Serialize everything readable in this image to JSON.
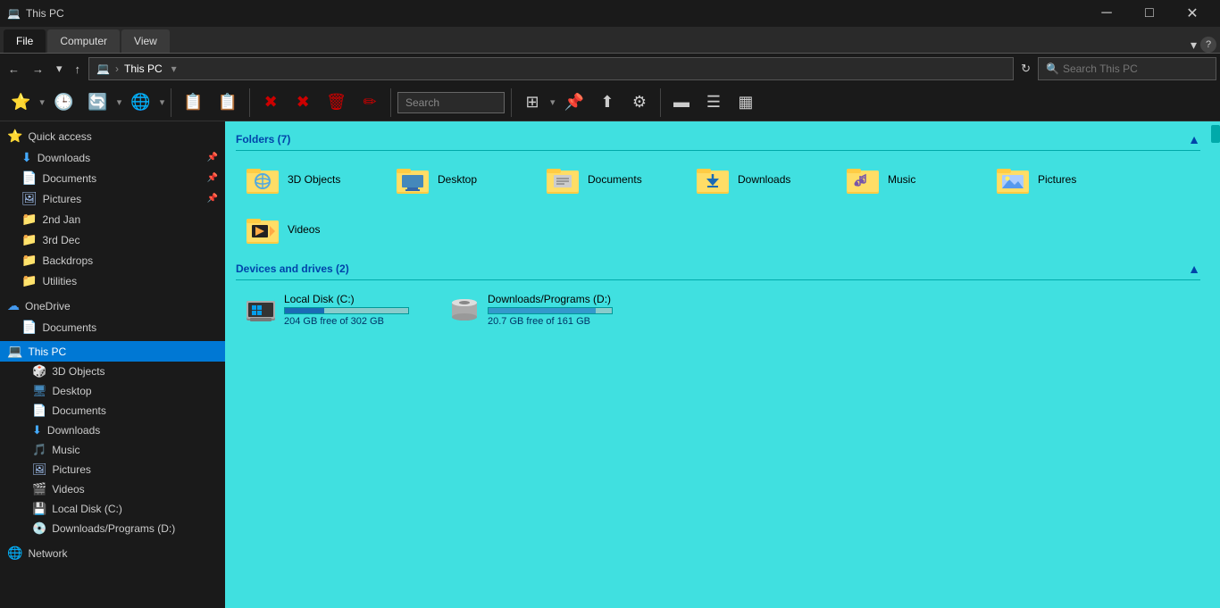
{
  "titlebar": {
    "icon": "💻",
    "title": "This PC",
    "minimize": "─",
    "maximize": "□",
    "close": "✕"
  },
  "ribbon": {
    "tabs": [
      "File",
      "Computer",
      "View"
    ],
    "active_tab": "File",
    "chevron_down": "▾",
    "help": "?"
  },
  "addressbar": {
    "back": "←",
    "forward": "→",
    "recent": "▾",
    "up": "↑",
    "breadcrumb_computer": "💻",
    "breadcrumb_sep": "›",
    "breadcrumb_location": "This PC",
    "dropdown": "▾",
    "refresh": "↻",
    "search_placeholder": "Search This PC",
    "search_icon": "🔍"
  },
  "toolbar": {
    "search_placeholder": "Search",
    "search_value": "",
    "buttons": [
      {
        "icon": "⭐",
        "label": "",
        "has_dropdown": true,
        "name": "favorites-btn"
      },
      {
        "icon": "🕒",
        "label": "",
        "name": "history-btn"
      },
      {
        "icon": "🔄",
        "label": "",
        "has_dropdown": true,
        "name": "sync-btn"
      },
      {
        "icon": "🌐",
        "label": "",
        "has_dropdown": true,
        "name": "network-btn"
      },
      {
        "icon": "📋",
        "label": "",
        "name": "copy-to-btn"
      },
      {
        "icon": "📋",
        "label": "",
        "name": "move-to-btn"
      },
      {
        "icon": "✖",
        "label": "",
        "name": "delete-x-btn"
      },
      {
        "icon": "✖",
        "label": "",
        "name": "remove-btn"
      },
      {
        "icon": "🗑",
        "label": "",
        "name": "delete-btn"
      },
      {
        "icon": "✏",
        "label": "",
        "name": "rename-btn"
      },
      {
        "icon": "⊞",
        "label": "",
        "has_dropdown": true,
        "name": "view-btn"
      },
      {
        "icon": "📌",
        "label": "",
        "name": "pin-btn"
      },
      {
        "icon": "⬆",
        "label": "",
        "name": "upload-btn"
      },
      {
        "icon": "⚙",
        "label": "",
        "name": "settings-btn"
      },
      {
        "icon": "▬",
        "label": "",
        "name": "size1-btn"
      },
      {
        "icon": "☰",
        "label": "",
        "name": "size2-btn"
      },
      {
        "icon": "▦",
        "label": "",
        "name": "size3-btn"
      }
    ]
  },
  "sidebar": {
    "quick_access": {
      "label": "Quick access",
      "icon": "⭐",
      "items": [
        {
          "label": "Downloads",
          "icon": "⬇",
          "name": "sidebar-downloads",
          "pinned": true
        },
        {
          "label": "Documents",
          "icon": "📄",
          "name": "sidebar-documents",
          "pinned": true
        },
        {
          "label": "Pictures",
          "icon": "🖼",
          "name": "sidebar-pictures",
          "pinned": true
        },
        {
          "label": "2nd Jan",
          "icon": "📁",
          "name": "sidebar-2ndjan"
        },
        {
          "label": "3rd Dec",
          "icon": "📁",
          "name": "sidebar-3rddec"
        },
        {
          "label": "Backdrops",
          "icon": "📁",
          "name": "sidebar-backdrops"
        },
        {
          "label": "Utilities",
          "icon": "📁",
          "name": "sidebar-utilities"
        }
      ]
    },
    "onedrive": {
      "label": "OneDrive",
      "icon": "☁",
      "items": [
        {
          "label": "Documents",
          "icon": "📄",
          "name": "sidebar-od-documents"
        }
      ]
    },
    "this_pc": {
      "label": "This PC",
      "icon": "💻",
      "items": [
        {
          "label": "3D Objects",
          "icon": "🎲",
          "name": "sidebar-3dobjects"
        },
        {
          "label": "Desktop",
          "icon": "🖥",
          "name": "sidebar-desktop"
        },
        {
          "label": "Documents",
          "icon": "📄",
          "name": "sidebar-pc-documents"
        },
        {
          "label": "Downloads",
          "icon": "⬇",
          "name": "sidebar-pc-downloads"
        },
        {
          "label": "Music",
          "icon": "🎵",
          "name": "sidebar-music"
        },
        {
          "label": "Pictures",
          "icon": "🖼",
          "name": "sidebar-pc-pictures"
        },
        {
          "label": "Videos",
          "icon": "🎬",
          "name": "sidebar-videos"
        },
        {
          "label": "Local Disk (C:)",
          "icon": "💾",
          "name": "sidebar-localc"
        },
        {
          "label": "Downloads/Programs (D:)",
          "icon": "💿",
          "name": "sidebar-dromd"
        }
      ]
    },
    "network": {
      "label": "Network",
      "icon": "🌐",
      "name": "sidebar-network"
    }
  },
  "content": {
    "folders_section": {
      "label": "Folders (7)",
      "collapse_icon": "▲"
    },
    "folders": [
      {
        "name": "3D Objects",
        "icon": "3d",
        "color": "#5599cc"
      },
      {
        "name": "Desktop",
        "icon": "desktop",
        "color": "#4488bb"
      },
      {
        "name": "Documents",
        "icon": "docs",
        "color": "#ffcc44"
      },
      {
        "name": "Downloads",
        "icon": "downloads",
        "color": "#ffcc44"
      },
      {
        "name": "Music",
        "icon": "music",
        "color": "#ffcc44"
      },
      {
        "name": "Pictures",
        "icon": "pictures",
        "color": "#ffcc44"
      },
      {
        "name": "Videos",
        "icon": "videos",
        "color": "#ffcc44"
      }
    ],
    "drives_section": {
      "label": "Devices and drives (2)",
      "collapse_icon": "▲"
    },
    "drives": [
      {
        "name": "Local Disk (C:)",
        "free": "204 GB free of 302 GB",
        "fill_percent": 32,
        "bar_class": "c",
        "icon": "win"
      },
      {
        "name": "Downloads/Programs (D:)",
        "free": "20.7 GB free of 161 GB",
        "fill_percent": 87,
        "bar_class": "d",
        "icon": "disk"
      }
    ]
  },
  "statusbar": {
    "item_count": "",
    "view_icons": [
      "⊞",
      "☰"
    ]
  }
}
